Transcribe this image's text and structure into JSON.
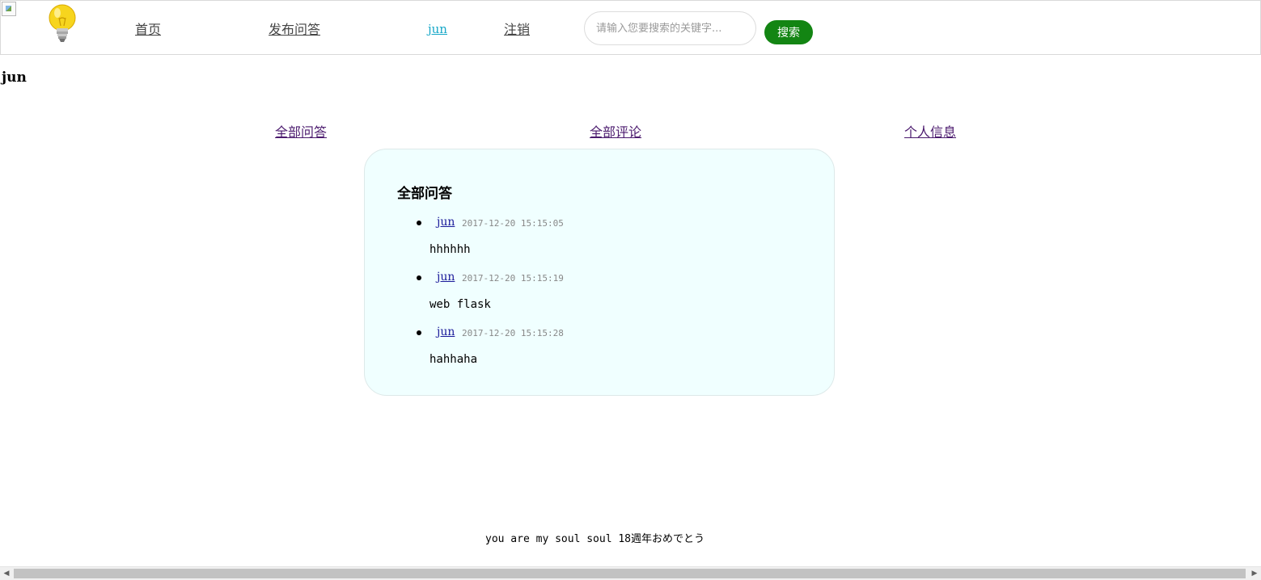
{
  "nav": {
    "home": "首页",
    "publish": "发布问答",
    "user": "jun",
    "logout": "注销",
    "search_placeholder": "请输入您要搜索的关键字...",
    "search_button": "搜索"
  },
  "profile": {
    "username": "jun",
    "tabs": [
      "全部问答",
      "全部评论",
      "个人信息"
    ]
  },
  "panel": {
    "title": "全部问答",
    "questions": [
      {
        "author": "jun",
        "time": "2017-12-20 15:15:05",
        "content": "hhhhhh"
      },
      {
        "author": "jun",
        "time": "2017-12-20 15:15:19",
        "content": "web flask"
      },
      {
        "author": "jun",
        "time": "2017-12-20 15:15:28",
        "content": "hahhaha"
      }
    ]
  },
  "footer": {
    "text": "you are my soul soul 18週年おめでとう"
  },
  "icons": {
    "logo": "lightbulb-icon",
    "broken_image": "broken-image-icon",
    "scroll_left": "scroll-left-arrow-icon",
    "scroll_right": "scroll-right-arrow-icon"
  },
  "colors": {
    "search_button": "#138513",
    "panel_background": "#f0ffff",
    "active_user_link": "#18a8c8",
    "visited_link": "#4b1a6e"
  }
}
